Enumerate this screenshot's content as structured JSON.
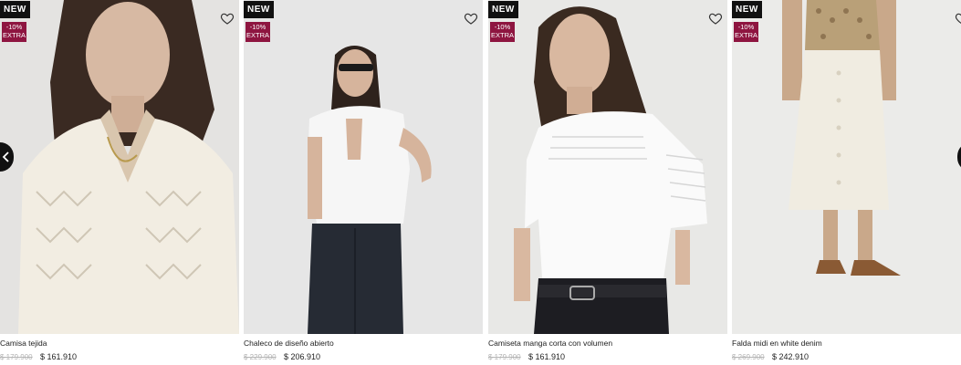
{
  "colors": {
    "badge_new_bg": "#111111",
    "discount_bg": "#8e1540",
    "old_price": "#b4b4b4"
  },
  "icons": {
    "favorite": "heart-outline-icon",
    "prev": "chevron-left-icon",
    "next": "chevron-right-icon"
  },
  "products": [
    {
      "badge": "NEW",
      "discount": "-10%",
      "discount_sub": "EXTRA",
      "name": "Camisa tejida",
      "old_price": "$ 179.900",
      "price": "$ 161.910"
    },
    {
      "badge": "NEW",
      "discount": "-10%",
      "discount_sub": "EXTRA",
      "name": "Chaleco de diseño abierto",
      "old_price": "$ 229.900",
      "price": "$ 206.910"
    },
    {
      "badge": "NEW",
      "discount": "-10%",
      "discount_sub": "EXTRA",
      "name": "Camiseta manga corta con volumen",
      "old_price": "$ 179.900",
      "price": "$ 161.910"
    },
    {
      "badge": "NEW",
      "discount": "-10%",
      "discount_sub": "EXTRA",
      "name": "Falda midi en white denim",
      "old_price": "$ 269.900",
      "price": "$ 242.910"
    }
  ]
}
